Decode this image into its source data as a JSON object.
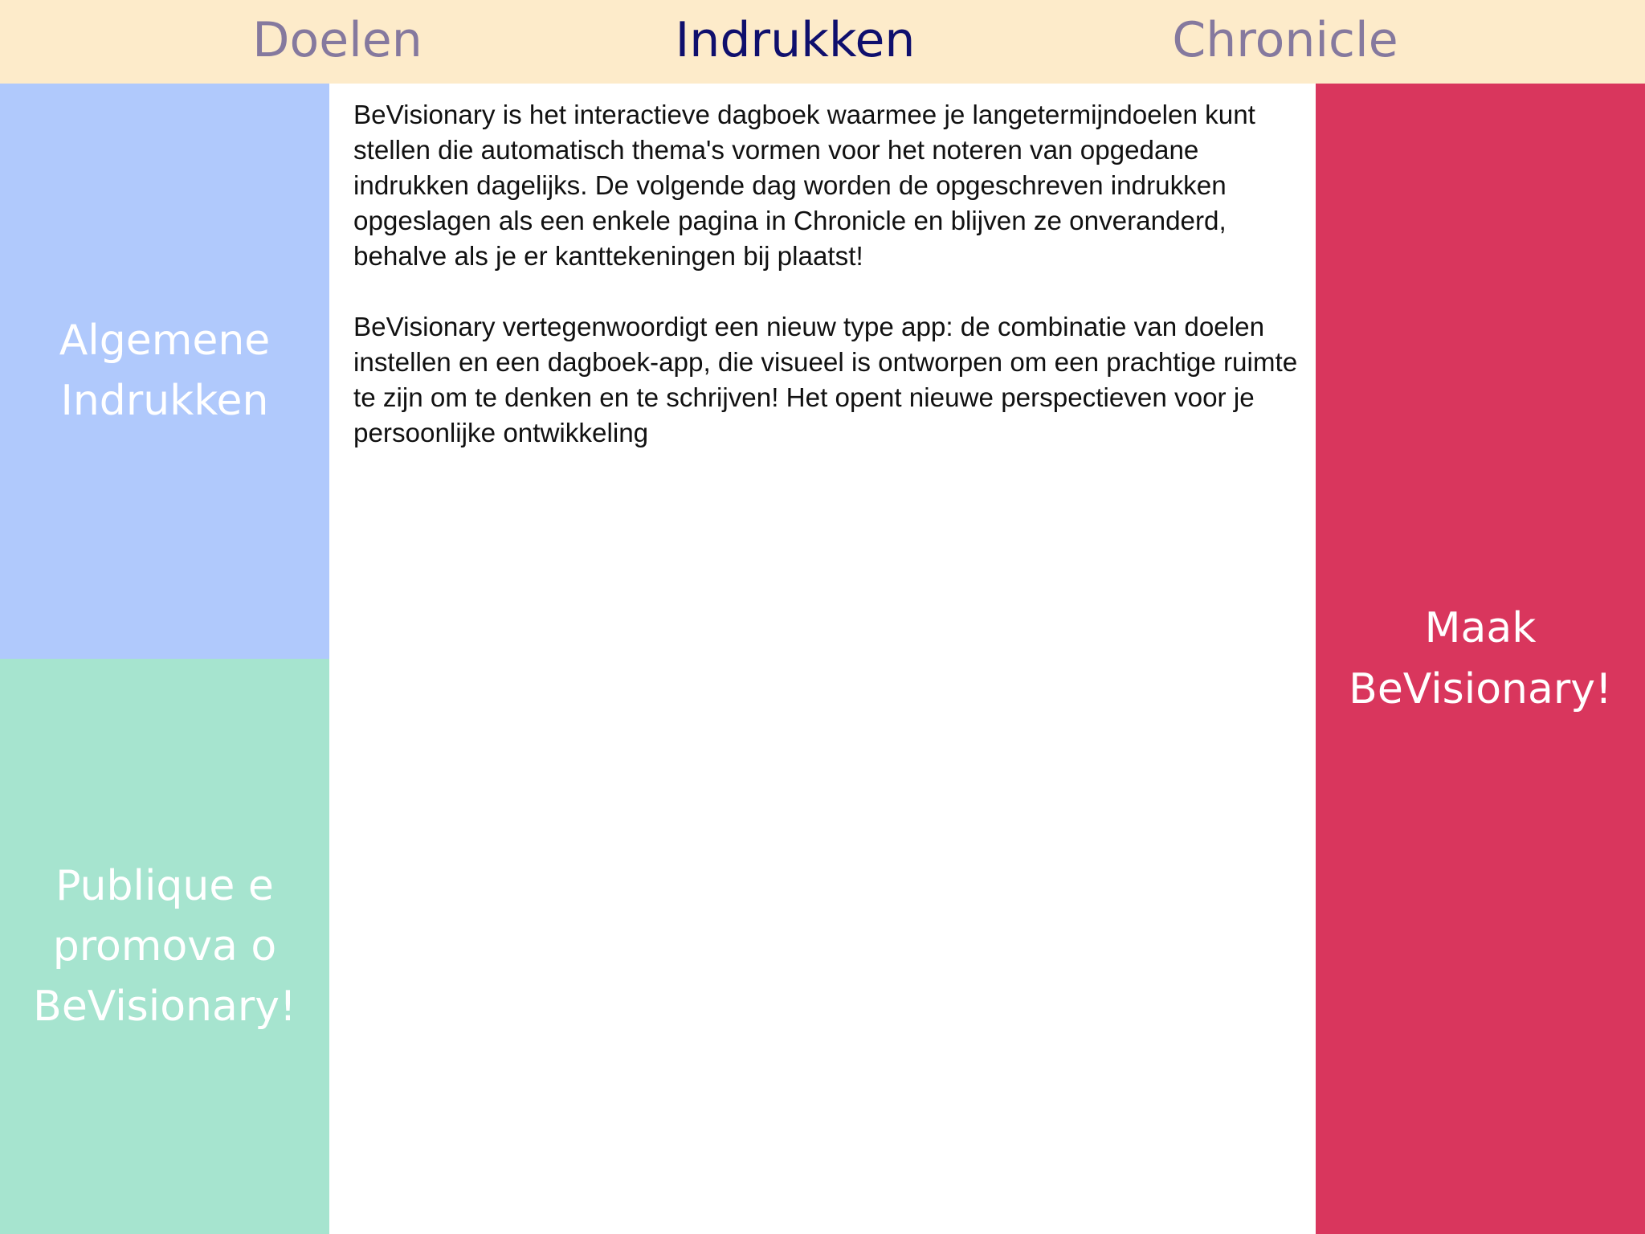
{
  "tabs": {
    "goals": "Doelen",
    "impressions": "Indrukken",
    "chronicle": "Chronicle",
    "active": "impressions"
  },
  "sidebar": {
    "general_impressions": "Algemene\nIndrukken",
    "publish_promote": "Publique e\npromova o\nBeVisionary!"
  },
  "cta": {
    "make_bevisionary": "Maak\nBeVisionary!"
  },
  "content": {
    "paragraph_1": "BeVisionary is het interactieve dagboek waarmee je langetermijndoelen kunt stellen die automatisch thema's vormen voor het noteren van opgedane indrukken dagelijks. De volgende dag worden de opgeschreven indrukken opgeslagen als een enkele pagina in Chronicle en blijven ze onveranderd, behalve als je er kanttekeningen bij plaatst!",
    "paragraph_2": "BeVisionary vertegenwoordigt een nieuw type app: de combinatie van doelen instellen en een dagboek-app, die visueel is ontworpen om een prachtige ruimte te zijn om te denken en te schrijven! Het opent nieuwe perspectieven voor je persoonlijke ontwikkeling"
  },
  "colors": {
    "tabbar_bg": "#fdebca",
    "tab_inactive": "#85799e",
    "tab_active": "#0f0f6d",
    "general_panel": "#b0c9fc",
    "publish_panel": "#a6e4cf",
    "make_panel": "#d9365d"
  }
}
